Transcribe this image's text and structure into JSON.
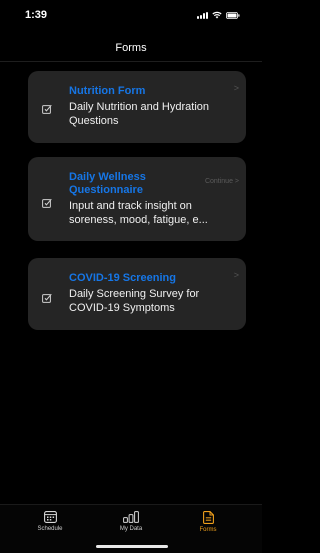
{
  "status_bar": {
    "time": "1:39"
  },
  "header": {
    "title": "Forms"
  },
  "forms": [
    {
      "title": "Nutrition Form",
      "description": "Daily Nutrition and Hydration Questions",
      "action": ">"
    },
    {
      "title": "Daily Wellness Questionnaire",
      "description": "Input and track insight on soreness, mood, fatigue, e...",
      "action": "Continue >"
    },
    {
      "title": "COVID-19 Screening",
      "description": "Daily Screening Survey for COVID-19 Symptoms",
      "action": ">"
    }
  ],
  "tab_bar": {
    "tabs": [
      {
        "label": "Schedule",
        "icon": "calendar-icon",
        "active": false
      },
      {
        "label": "My Data",
        "icon": "bar-chart-icon",
        "active": false
      },
      {
        "label": "Forms",
        "icon": "document-icon",
        "active": true
      }
    ]
  },
  "colors": {
    "accent": "#1676e6",
    "active_tab": "#f0a01c",
    "card_bg": "#252525",
    "background": "#000000"
  }
}
